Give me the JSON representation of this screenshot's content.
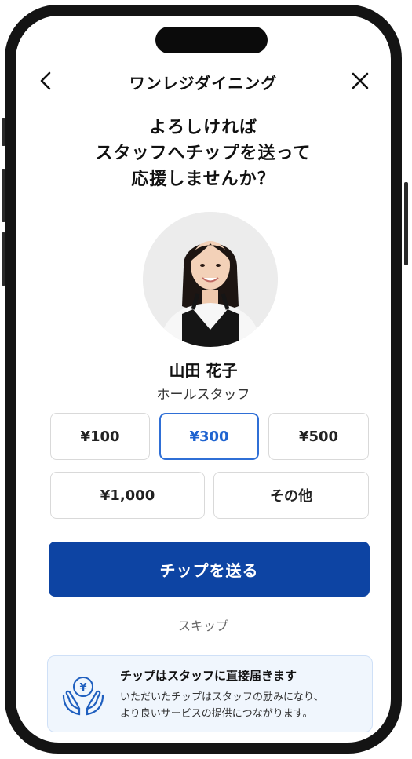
{
  "header": {
    "title": "ワンレジダイニング"
  },
  "prompt": {
    "line1": "よろしければ",
    "line2": "スタッフへチップを送って",
    "line3": "応援しませんか？"
  },
  "staff": {
    "name": "山田 花子",
    "role": "ホールスタッフ"
  },
  "amounts": [
    {
      "label": "¥100",
      "selected": false
    },
    {
      "label": "¥300",
      "selected": true
    },
    {
      "label": "¥500",
      "selected": false
    },
    {
      "label": "¥1,000",
      "selected": false
    },
    {
      "label": "その他",
      "selected": false
    }
  ],
  "actions": {
    "send_label": "チップを送る",
    "skip_label": "スキップ"
  },
  "info": {
    "title": "チップはスタッフに直接届きます",
    "body_line1": "いただいたチップはスタッフの励みになり、",
    "body_line2": "より良いサービスの提供につながります。"
  },
  "colors": {
    "primary": "#0d44a3",
    "selected_accent": "#2f6fd6",
    "info_background": "#f0f6fd",
    "icon_blue": "#1f5fbf"
  },
  "icons": {
    "back": "chevron-left-icon",
    "close": "close-icon",
    "info": "yen-coin-hands-icon"
  }
}
